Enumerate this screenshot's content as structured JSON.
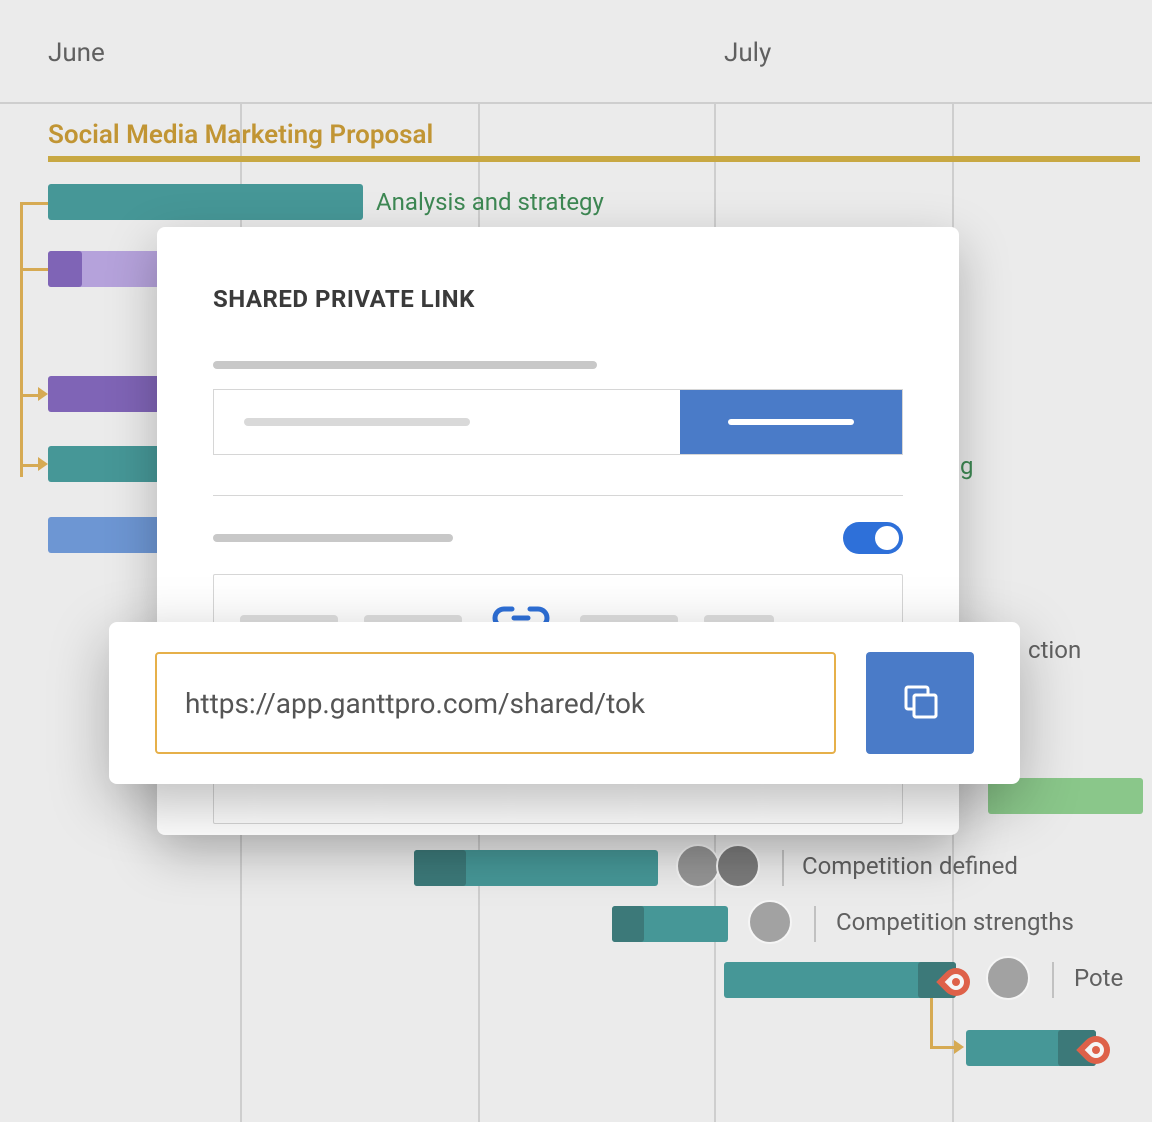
{
  "timeline": {
    "months": {
      "june": "June",
      "july": "July"
    }
  },
  "project": {
    "title": "Social Media Marketing Proposal",
    "group_label": "Analysis and strategy"
  },
  "tasks": {
    "partial_right_1": "g",
    "partial_right_2": "ction",
    "competition_defined": "Competition defined",
    "competition_strengths": "Competition strengths",
    "pote": "Pote"
  },
  "dialog": {
    "title": "SHARED PRIVATE LINK"
  },
  "share": {
    "url": "https://app.ganttpro.com/shared/tok"
  },
  "icons": {
    "link": "link-icon",
    "copy": "copy-icon",
    "flame": "flame-icon",
    "avatar": "avatar"
  }
}
